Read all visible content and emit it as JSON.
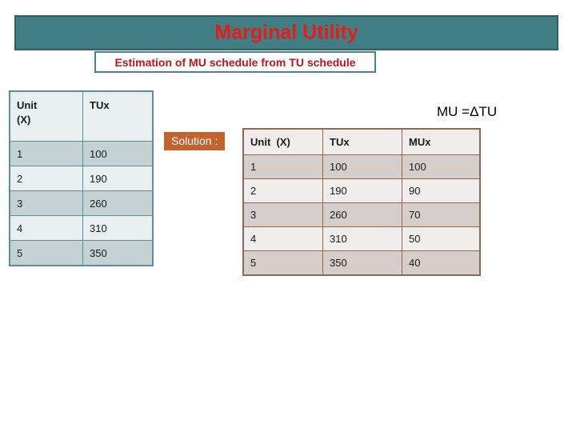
{
  "title": {
    "text": "Marginal Utility",
    "color": "#e81b16",
    "banner_color": "#417e84"
  },
  "subtitle": {
    "text": "Estimation of MU schedule from TU schedule",
    "color": "#c0161a"
  },
  "formula": {
    "text": "MU =ΔTU"
  },
  "solution": {
    "label": "Solution :",
    "background": "#c2622c"
  },
  "tu_table": {
    "headers": [
      "Unit\n(X)",
      "TUx"
    ],
    "rows": [
      [
        "1",
        "100"
      ],
      [
        "2",
        "190"
      ],
      [
        "3",
        "260"
      ],
      [
        "4",
        "310"
      ],
      [
        "5",
        "350"
      ]
    ]
  },
  "mu_table": {
    "headers": [
      "Unit  (X)",
      "TUx",
      "MUx"
    ],
    "rows": [
      [
        "1",
        "100",
        "100"
      ],
      [
        "2",
        "190",
        "90"
      ],
      [
        "3",
        "260",
        "70"
      ],
      [
        "4",
        "310",
        "50"
      ],
      [
        "5",
        "350",
        "40"
      ]
    ]
  }
}
